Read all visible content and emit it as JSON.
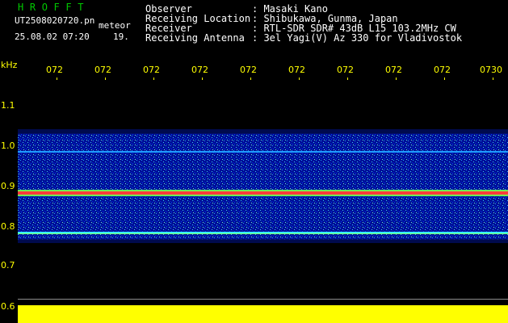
{
  "header": {
    "app_title": "H R O F F T",
    "file_name": "UT2508020720.pn",
    "file_ext": "meteor",
    "date_time": "25.08.02 07:20",
    "count": "19."
  },
  "metadata": [
    {
      "label": "Observer",
      "value": ": Masaki Kano"
    },
    {
      "label": "Receiving Location",
      "value": ": Shibukawa, Gunma, Japan"
    },
    {
      "label": "Receiver",
      "value": ": RTL-SDR SDR# 43dB L15 103.2MHz CW"
    },
    {
      "label": "Receiving Antenna",
      "value": ": 3el Yagi(V) Az 330 for Vladivostok"
    }
  ],
  "axes": {
    "y_unit": "kHz",
    "y_ticks": [
      "1.1",
      "1.0",
      "0.9",
      "0.8",
      "0.7",
      "0.6"
    ],
    "x_ticks": [
      "072",
      "072",
      "072",
      "072",
      "072",
      "072",
      "072",
      "072",
      "072",
      "0730"
    ]
  },
  "colors": {
    "background": "#000000",
    "header_title": "#00c800",
    "axis_text": "#ffff00",
    "signal_band": "#0000c8",
    "noise_bar": "#ffff00"
  },
  "chart_data": {
    "type": "heatmap",
    "xlabel": "",
    "ylabel": "kHz",
    "ylim": [
      0.6,
      1.1
    ],
    "x_ticks": [
      "072",
      "072",
      "072",
      "072",
      "072",
      "072",
      "072",
      "072",
      "072",
      "0730"
    ],
    "band": {
      "from_khz": 0.77,
      "to_khz": 1.0
    },
    "lines_khz": [
      0.98,
      0.88,
      0.78
    ]
  }
}
